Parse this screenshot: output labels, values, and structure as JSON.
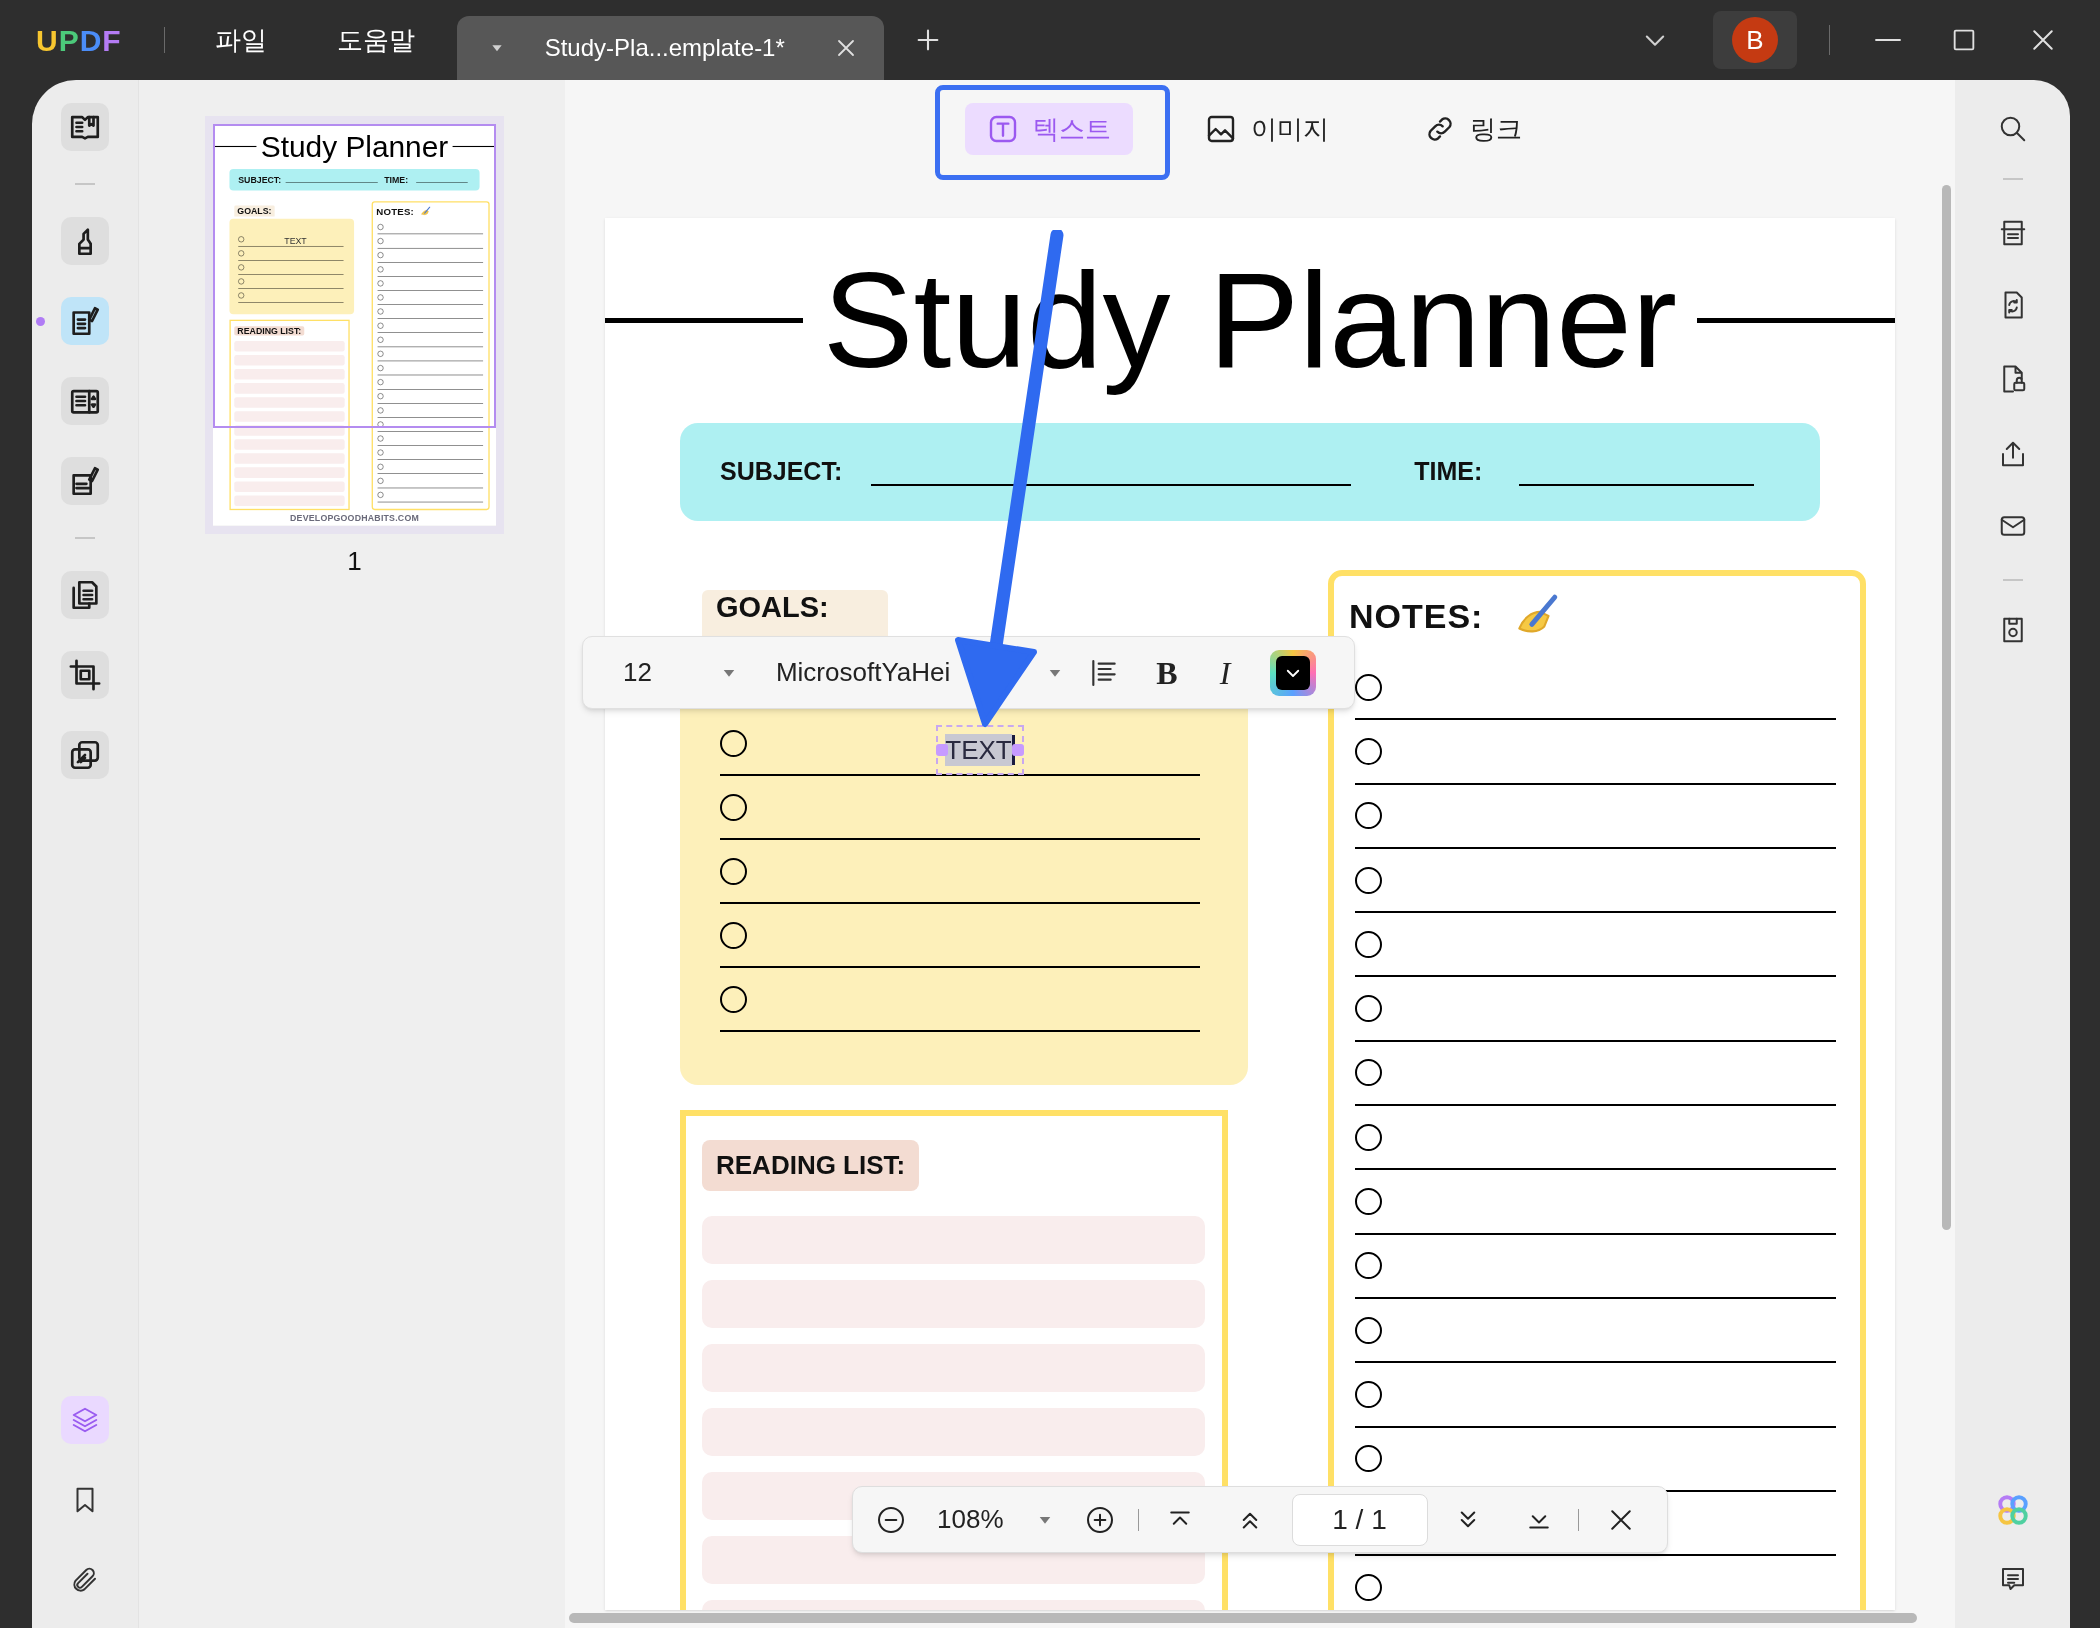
{
  "title_bar": {
    "logo": "UPDF",
    "menus": [
      "파일",
      "도움말"
    ],
    "tab": {
      "title": "Study-Pla...emplate-1*"
    },
    "avatar": "B"
  },
  "tools": [
    {
      "kind": "reader",
      "selected": false
    },
    {
      "kind": "comment",
      "selected": false
    },
    {
      "kind": "edit",
      "selected": true
    },
    {
      "kind": "organize",
      "selected": false
    },
    {
      "kind": "fill",
      "selected": false
    },
    {
      "kind": "pages",
      "selected": false
    },
    {
      "kind": "crop",
      "selected": false
    },
    {
      "kind": "overlay",
      "selected": false
    }
  ],
  "bottom_tools": [
    {
      "kind": "layers",
      "selected": true
    },
    {
      "kind": "bookmarks",
      "selected": false
    },
    {
      "kind": "attachments",
      "selected": false
    }
  ],
  "thumbnail": {
    "page": {
      "title": "Study Planner",
      "subject_label": "SUBJECT:",
      "time_label": "TIME:",
      "goals_label": "GOALS:",
      "goal_text": "TEXT",
      "text_editing": false,
      "notes_label": "NOTES:",
      "reading_label": "READING LIST:",
      "footer": "DEVELOPGOODHABITS.COM"
    },
    "page_number": "1"
  },
  "edit_modes": [
    {
      "kind": "text",
      "label": "텍스트",
      "selected": true
    },
    {
      "kind": "image",
      "label": "이미지",
      "selected": false
    },
    {
      "kind": "link",
      "label": "링크",
      "selected": false
    }
  ],
  "page": {
    "title": "Study Planner",
    "subject_label": "SUBJECT:",
    "time_label": "TIME:",
    "goals_label": "GOALS:",
    "goal_text": "TEXT",
    "text_editing": true,
    "notes_label": "NOTES:",
    "reading_label": "READING LIST:"
  },
  "format_bar": {
    "font_size": "12",
    "font": "MicrosoftYaHei",
    "bold": "B",
    "italic": "I"
  },
  "zoom_bar": {
    "zoom": "108%",
    "page": "1 / 1"
  }
}
